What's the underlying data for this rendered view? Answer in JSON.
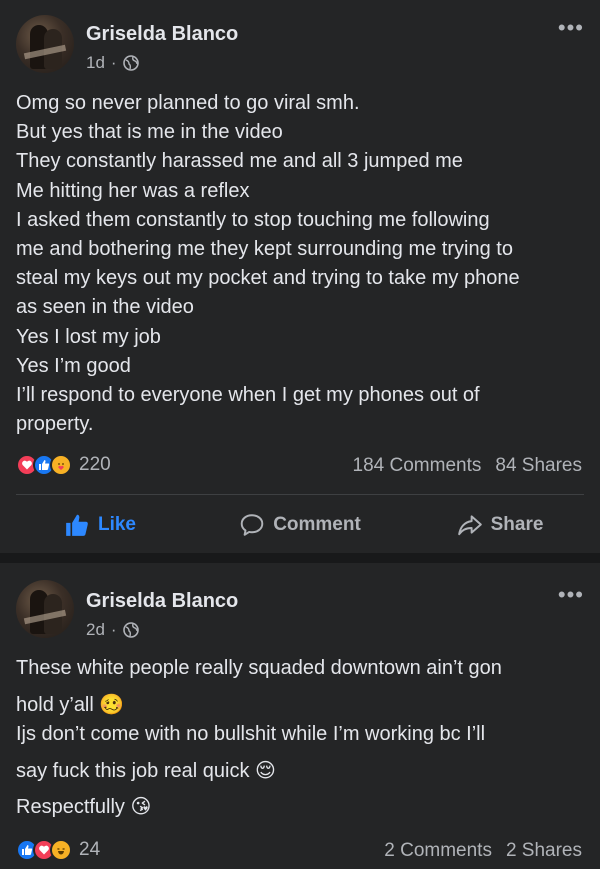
{
  "posts": [
    {
      "author": "Griselda Blanco",
      "time": "1d",
      "separator": "·",
      "privacy_icon": "globe-icon",
      "more_label": "•••",
      "lines": [
        "Omg so never planned to go viral smh.",
        "But yes that is me in the video",
        "They constantly harassed me and all 3 jumped me",
        "Me hitting her was a reflex",
        "I asked them constantly to stop touching me following",
        "me and bothering me they kept surrounding me trying to",
        "steal my keys out my pocket and trying to take my phone",
        "as seen in the video",
        "Yes I lost my job",
        "Yes I’m good",
        "I’ll respond to everyone when I get my phones out of",
        "property."
      ],
      "reactions": [
        "love",
        "like",
        "care"
      ],
      "reaction_count": "220",
      "comments": "184 Comments",
      "shares": "84 Shares",
      "actions": {
        "like": "Like",
        "comment": "Comment",
        "share": "Share"
      }
    },
    {
      "author": "Griselda Blanco",
      "time": "2d",
      "separator": "·",
      "privacy_icon": "globe-icon",
      "more_label": "•••",
      "lines": [
        "These white people really squaded downtown ain’t gon",
        "hold y’all 🥴",
        "Ijs don’t come with no bullshit while I’m working bc I’ll",
        "say fuck this job real quick 😌",
        "Respectfully 😘"
      ],
      "reactions": [
        "like",
        "love",
        "haha"
      ],
      "reaction_count": "24",
      "comments": "2 Comments",
      "shares": "2 Shares"
    }
  ],
  "colors": {
    "background": "#18191a",
    "card": "#242526",
    "primary_text": "#e4e6eb",
    "secondary_text": "#b0b3b8",
    "accent": "#2d88ff"
  }
}
